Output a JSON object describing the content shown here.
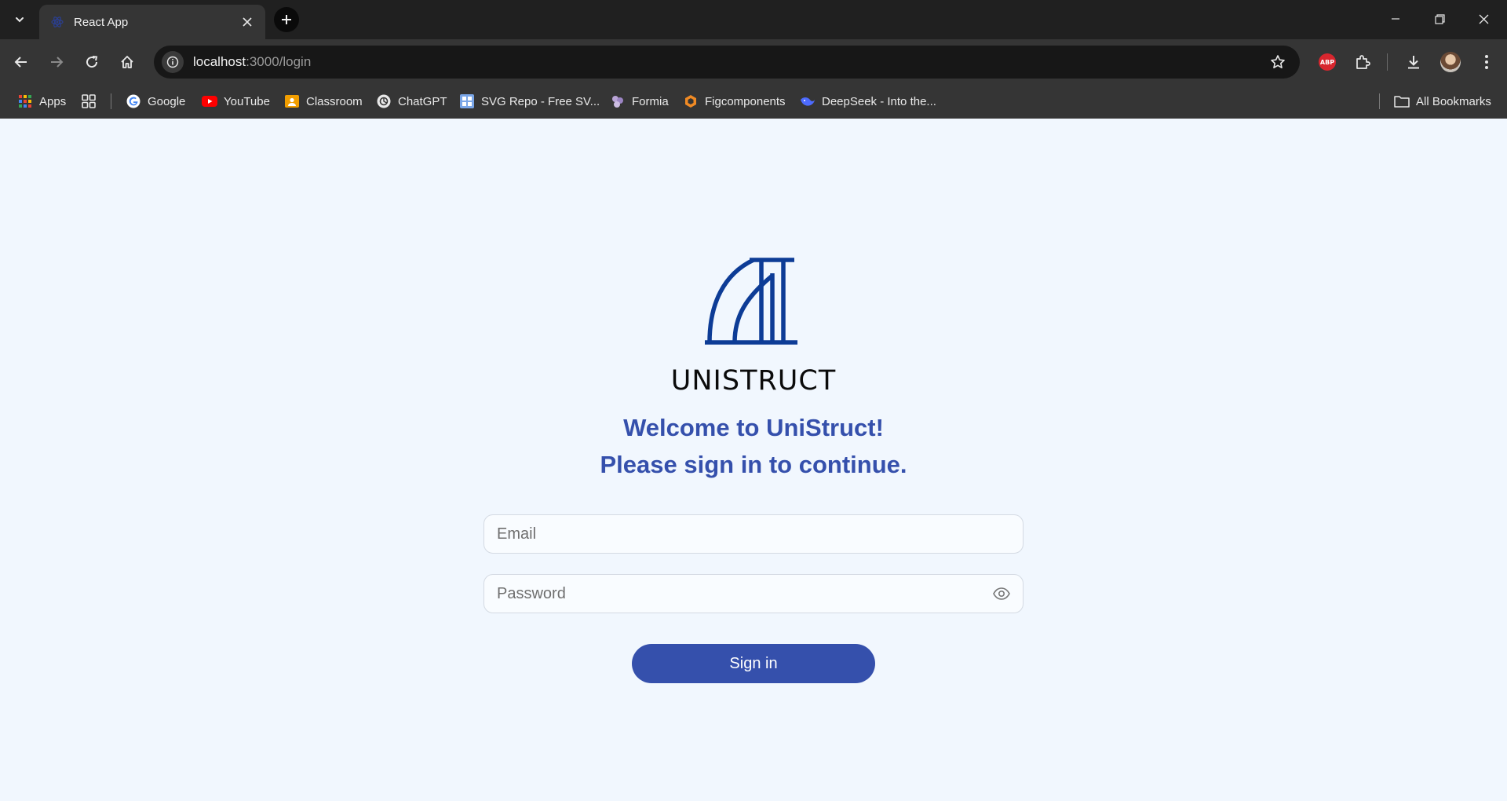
{
  "browser": {
    "tab": {
      "title": "React App",
      "favicon": "react-icon"
    },
    "address_bar": {
      "host": "localhost",
      "path": ":3000/login"
    },
    "extensions": {
      "adblock_label": "ABP"
    },
    "bookmarks": [
      {
        "label": "Apps",
        "icon": "apps-grid-icon"
      },
      {
        "label": "Google",
        "icon": "google-icon"
      },
      {
        "label": "YouTube",
        "icon": "youtube-icon"
      },
      {
        "label": "Classroom",
        "icon": "classroom-icon"
      },
      {
        "label": "ChatGPT",
        "icon": "chatgpt-icon"
      },
      {
        "label": "SVG Repo - Free SV...",
        "icon": "svgrepo-icon"
      },
      {
        "label": "Formia",
        "icon": "formia-icon"
      },
      {
        "label": "Figcomponents",
        "icon": "figcomponents-icon"
      },
      {
        "label": "DeepSeek - Into the...",
        "icon": "deepseek-icon"
      }
    ],
    "all_bookmarks_label": "All Bookmarks"
  },
  "login": {
    "brand_name": "UNISTRUCT",
    "welcome_line1": "Welcome to UniStruct!",
    "welcome_line2": "Please sign in to continue.",
    "email_placeholder": "Email",
    "password_placeholder": "Password",
    "signin_label": "Sign in"
  },
  "colors": {
    "page_background": "#f1f7fe",
    "brand_blue": "#3550ac",
    "logo_blue": "#0d3c96",
    "chrome_dark": "#353535"
  }
}
